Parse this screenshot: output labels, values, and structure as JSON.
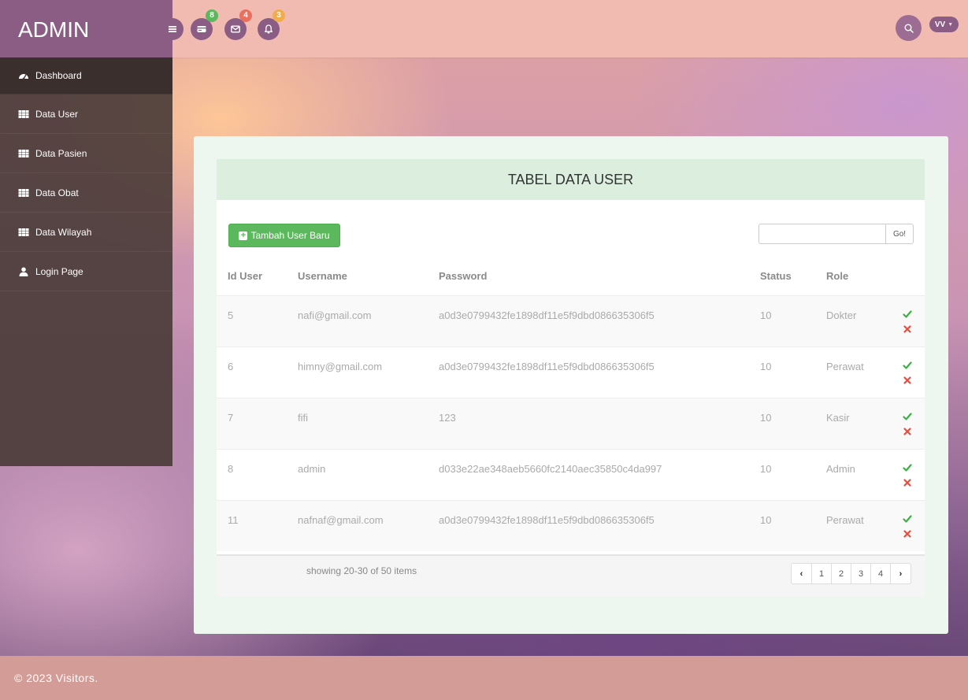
{
  "brand": {
    "title": "ADMIN"
  },
  "topbar": {
    "notifications": [
      {
        "icon": "wallet-icon",
        "count": "8",
        "color": "#5cb85c"
      },
      {
        "icon": "envelope-icon",
        "count": "4",
        "color": "#e96f5f"
      },
      {
        "icon": "bell-icon",
        "count": "3",
        "color": "#f0ad4e"
      }
    ],
    "user_initials": "VV",
    "user_caret": "▼"
  },
  "sidebar": {
    "items": [
      {
        "label": "Dashboard",
        "icon": "dashboard-icon"
      },
      {
        "label": "Data User",
        "icon": "table-icon"
      },
      {
        "label": "Data Pasien",
        "icon": "table-icon"
      },
      {
        "label": "Data Obat",
        "icon": "table-icon"
      },
      {
        "label": "Data Wilayah",
        "icon": "table-icon"
      },
      {
        "label": "Login Page",
        "icon": "user-icon"
      }
    ]
  },
  "table": {
    "title": "TABEL DATA USER",
    "add_button": "Tambah User Baru",
    "search": {
      "value": "",
      "placeholder": "",
      "button": "Go!"
    },
    "columns": [
      "Id User",
      "Username",
      "Password",
      "Status",
      "Role"
    ],
    "rows": [
      {
        "id": "5",
        "username": "nafi@gmail.com",
        "password": "a0d3e0799432fe1898df11e5f9dbd086635306f5",
        "status": "10",
        "role": "Dokter"
      },
      {
        "id": "6",
        "username": "himny@gmail.com",
        "password": "a0d3e0799432fe1898df11e5f9dbd086635306f5",
        "status": "10",
        "role": "Perawat"
      },
      {
        "id": "7",
        "username": "fifi",
        "password": "123",
        "status": "10",
        "role": "Kasir"
      },
      {
        "id": "8",
        "username": "admin",
        "password": "d033e22ae348aeb5660fc2140aec35850c4da997",
        "status": "10",
        "role": "Admin"
      },
      {
        "id": "11",
        "username": "nafnaf@gmail.com",
        "password": "a0d3e0799432fe1898df11e5f9dbd086635306f5",
        "status": "10",
        "role": "Perawat"
      }
    ],
    "footer_text": "showing 20-30 of 50 items",
    "pages": [
      "1",
      "2",
      "3",
      "4"
    ],
    "pager_prev": "‹",
    "pager_next": "›"
  },
  "footer": {
    "text": "© 2023 Visitors."
  },
  "colors": {
    "brand": "#8b5d84",
    "success": "#5cb85c",
    "danger": "#e74c3c",
    "header_bar": "#f1bbb2"
  }
}
